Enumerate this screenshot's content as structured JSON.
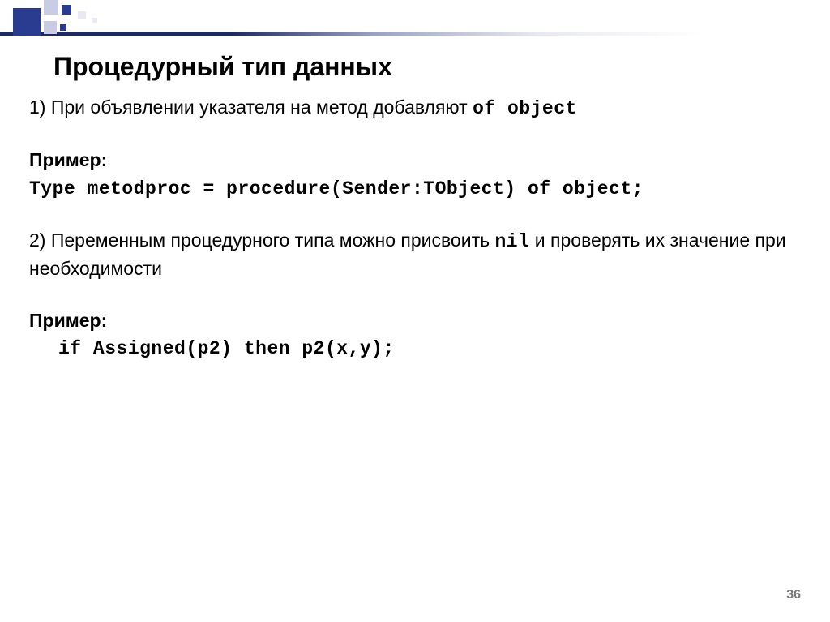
{
  "title": "Процедурный тип данных",
  "body": {
    "line1_prefix": "1) При объявлении указателя на метод добавляют ",
    "line1_code": "of object",
    "example_label1": "Пример:",
    "code1": "Type metodproc = procedure(Sender:TObject) of object;",
    "line2_prefix": "2) Переменным процедурного типа можно присвоить ",
    "line2_code": "nil",
    "line2_suffix": " и проверять их значение при необходимости",
    "example_label2": "Пример:",
    "code2": "if Assigned(p2) then p2(x,y);"
  },
  "page_number": "36"
}
